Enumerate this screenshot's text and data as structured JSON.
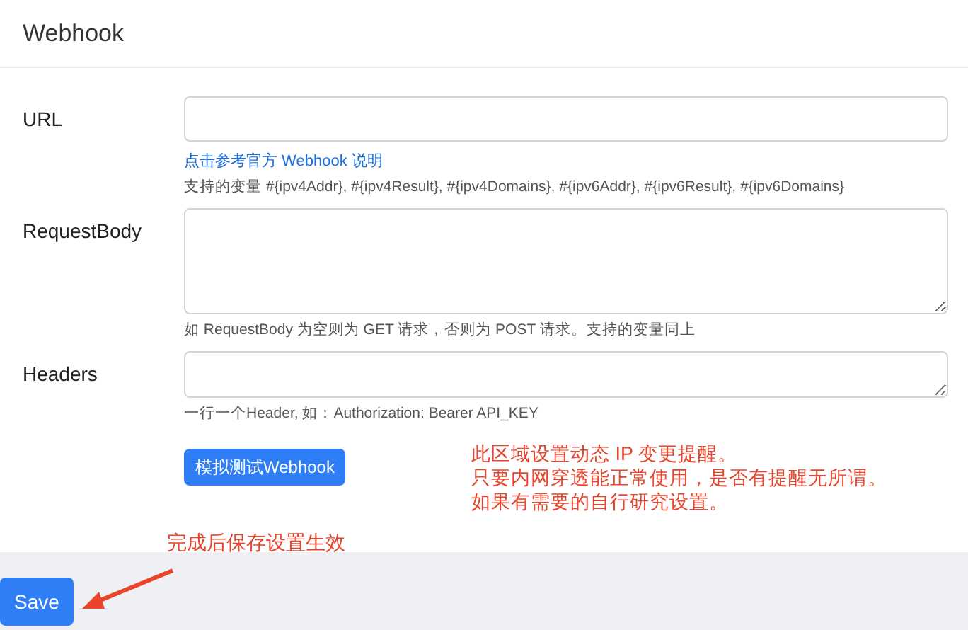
{
  "card": {
    "title": "Webhook",
    "fields": [
      {
        "label": "URL",
        "kind": "input",
        "link": "点击参考官方 Webhook 说明",
        "help": "支持的变量 #{ipv4Addr}, #{ipv4Result}, #{ipv4Domains}, #{ipv6Addr}, #{ipv6Result}, #{ipv6Domains}"
      },
      {
        "label": "RequestBody",
        "kind": "textarea-tall",
        "help": "如 RequestBody 为空则为 GET 请求，否则为 POST 请求。支持的变量同上"
      },
      {
        "label": "Headers",
        "kind": "textarea",
        "help": "一行一个Header, 如：Authorization: Bearer API_KEY"
      }
    ],
    "test_button": "模拟测试Webhook"
  },
  "save_button": "Save",
  "annotations": [
    {
      "kind": "note",
      "lines": [
        "此区域设置动态 IP 变更提醒。",
        "只要内网穿透能正常使用，是否有提醒无所谓。",
        "如果有需要的自行研究设置。"
      ]
    },
    {
      "kind": "arrow-note",
      "lines": [
        "完成后保存设置生效"
      ]
    }
  ]
}
